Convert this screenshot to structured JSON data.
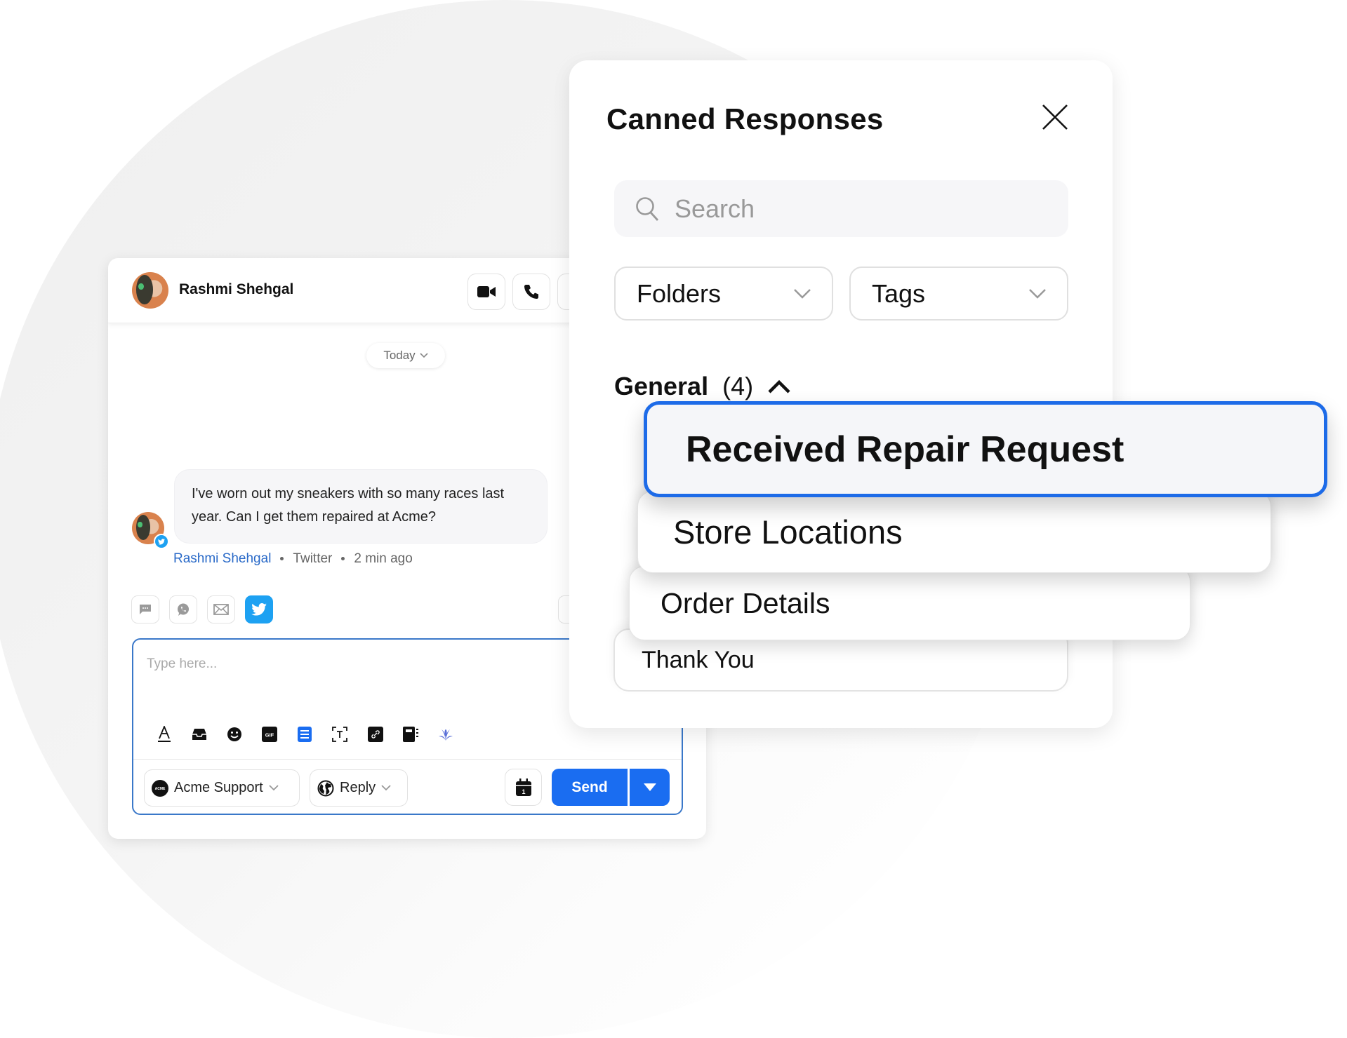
{
  "chat": {
    "contact_name": "Rashmi Shehgal",
    "header_buttons": [
      {
        "name": "video-call",
        "icon": "video-camera-icon"
      },
      {
        "name": "phone-call",
        "icon": "phone-icon"
      }
    ],
    "date_divider": "Today",
    "message": {
      "text": "I've worn out my sneakers with so many races last year. Can I get them repaired at Acme?",
      "author": "Rashmi Shehgal",
      "channel": "Twitter",
      "time": "2 min ago"
    },
    "channels": [
      {
        "name": "chat",
        "icon": "chat-bubble-icon",
        "active": false
      },
      {
        "name": "whatsapp",
        "icon": "whatsapp-icon",
        "active": false
      },
      {
        "name": "email",
        "icon": "envelope-icon",
        "active": false
      },
      {
        "name": "twitter",
        "icon": "twitter-icon",
        "active": true
      }
    ],
    "composer": {
      "placeholder": "Type here...",
      "tools": [
        "text-format-icon",
        "inbox-icon",
        "emoji-icon",
        "gif-icon",
        "canned-response-icon",
        "text-recognition-icon",
        "link-icon",
        "knowledge-base-icon",
        "ai-assist-icon"
      ],
      "from_account": "Acme Support",
      "from_logo": "ACME",
      "reply_mode": "Reply",
      "send_label": "Send",
      "schedule_day": "1"
    }
  },
  "canned": {
    "title": "Canned Responses",
    "search_placeholder": "Search",
    "filters": [
      "Folders",
      "Tags"
    ],
    "group": {
      "name": "General",
      "count": "(4)",
      "expanded": true
    },
    "items": [
      "Received Repair Request",
      "Store Locations",
      "Order Details",
      "Thank You"
    ],
    "selected_index": 0
  },
  "colors": {
    "accent": "#1a6df1",
    "selected_border": "#1d6be8",
    "author_link": "#2a6ac8",
    "twitter": "#1da1f2"
  }
}
